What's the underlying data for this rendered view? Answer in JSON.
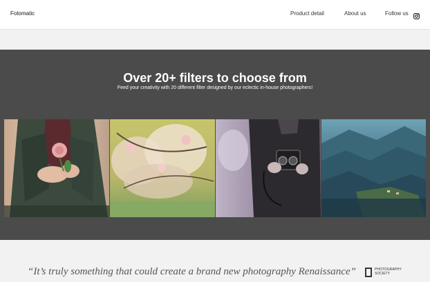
{
  "header": {
    "brand": "Fotomatic",
    "nav": {
      "product_detail": "Product detail",
      "about_us": "About us",
      "follow_us": "Follow us"
    },
    "follow_icon": "instagram-icon"
  },
  "feature": {
    "title": "Over 20+ filters to choose from",
    "subtitle": "Feed your creativity with 20 different filter designed by our eclectic in-house photographers!",
    "photos": [
      {
        "subject": "hands-holding-flower"
      },
      {
        "subject": "blossoming-tree"
      },
      {
        "subject": "person-with-vintage-camera"
      },
      {
        "subject": "mountain-valley"
      }
    ]
  },
  "quote": {
    "text": "“It’s truly something that could create a brand new photography Renaissance”",
    "source_logo_text": "PHOTOGRAPHY SOCIETY"
  },
  "colors": {
    "header_bg": "#ffffff",
    "feature_bg": "#4b4b4b",
    "page_bg": "#f2f2f2"
  }
}
